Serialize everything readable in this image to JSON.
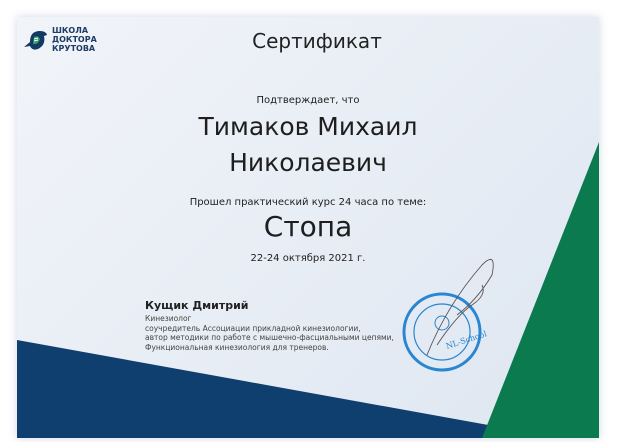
{
  "logo": {
    "line1": "ШКОЛА",
    "line2": "ДОКТОРА",
    "line3": "КРУТОВА"
  },
  "title": "Сертификат",
  "confirm": "Подтверждает, что",
  "recipient": {
    "line1": "Тимаков Михаил",
    "line2": "Николаевич"
  },
  "course_text": "Прошел практический курс 24 часа по теме:",
  "topic": "Стопа",
  "date": "22-24 октября 2021 г.",
  "signer": {
    "name": "Кущик Дмитрий",
    "lines": [
      "Кинезиолог",
      "соучредитель Ассоциации прикладной кинезиологии,",
      "автор методики по работе с мышечно-фасциальными цепями,",
      "Функциональная кинезиология для тренеров."
    ]
  },
  "stamp": {
    "text": "NL-School"
  },
  "colors": {
    "blue": "#0f3f6e",
    "green": "#0b7a4f",
    "brand": "#1d3c6a"
  }
}
